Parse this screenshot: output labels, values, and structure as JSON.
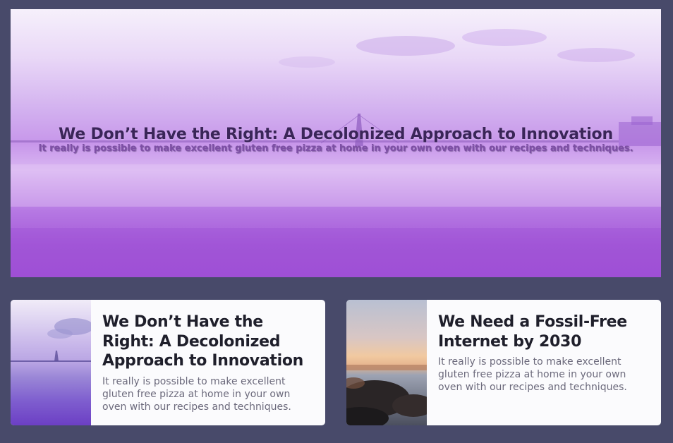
{
  "hero": {
    "title": "We Don’t Have the Right: A Decolonized Approach to Innovation",
    "subtitle": "It really is possible to make excellent gluten free pizza at home in your own oven with our recipes and techniques."
  },
  "cards": [
    {
      "title": "We Don’t Have the Right: A Decolonized Approach to Innovation",
      "text": "It really is possible to make excellent gluten free pizza at home in your own oven with our recipes and techniques.",
      "image": "bridge-sea-purple"
    },
    {
      "title": "We Need a Fossil-Free Internet by 2030",
      "text": "It really is possible to make excellent gluten free pizza at home in your own oven with our recipes and techniques.",
      "image": "rocky-shore-sunset"
    }
  ],
  "colors": {
    "page_background": "#484a6a",
    "card_background": "#fbfbfd",
    "accent_purple": "#a150d6"
  }
}
